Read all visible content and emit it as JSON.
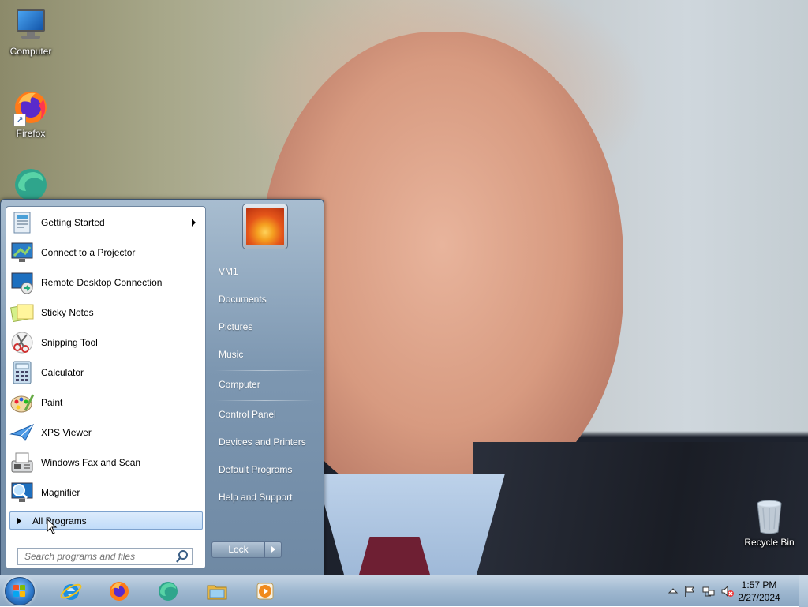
{
  "desktop": {
    "icons": [
      {
        "label": "Computer",
        "icon": "computer-icon"
      },
      {
        "label": "Firefox",
        "icon": "firefox-icon"
      },
      {
        "label": "",
        "icon": "edge-icon"
      },
      {
        "label": "Recycle Bin",
        "icon": "recycle-bin-icon"
      }
    ]
  },
  "start_menu": {
    "programs": [
      {
        "label": "Getting Started",
        "icon": "getting-started-icon",
        "has_submenu": true
      },
      {
        "label": "Connect to a Projector",
        "icon": "projector-icon"
      },
      {
        "label": "Remote Desktop Connection",
        "icon": "remote-desktop-icon"
      },
      {
        "label": "Sticky Notes",
        "icon": "sticky-notes-icon"
      },
      {
        "label": "Snipping Tool",
        "icon": "snipping-tool-icon"
      },
      {
        "label": "Calculator",
        "icon": "calculator-icon"
      },
      {
        "label": "Paint",
        "icon": "paint-icon"
      },
      {
        "label": "XPS Viewer",
        "icon": "xps-viewer-icon"
      },
      {
        "label": "Windows Fax and Scan",
        "icon": "fax-scan-icon"
      },
      {
        "label": "Magnifier",
        "icon": "magnifier-icon"
      }
    ],
    "all_programs": "All Programs",
    "search_placeholder": "Search programs and files",
    "right_items": [
      {
        "label": "VM1"
      },
      {
        "label": "Documents"
      },
      {
        "label": "Pictures"
      },
      {
        "label": "Music"
      },
      {
        "label": "Computer"
      },
      {
        "label": "Control Panel"
      },
      {
        "label": "Devices and Printers"
      },
      {
        "label": "Default Programs"
      },
      {
        "label": "Help and Support"
      }
    ],
    "lock_label": "Lock"
  },
  "taskbar": {
    "pinned": [
      {
        "name": "internet-explorer-icon"
      },
      {
        "name": "firefox-icon"
      },
      {
        "name": "edge-icon"
      },
      {
        "name": "file-explorer-icon"
      },
      {
        "name": "media-player-icon"
      }
    ],
    "clock": {
      "time": "1:57 PM",
      "date": "2/27/2024"
    }
  },
  "colors": {
    "start_menu_blue": "#7d97b1",
    "highlight": "#c1dcf9",
    "taskbar": "#9fb8d0"
  }
}
